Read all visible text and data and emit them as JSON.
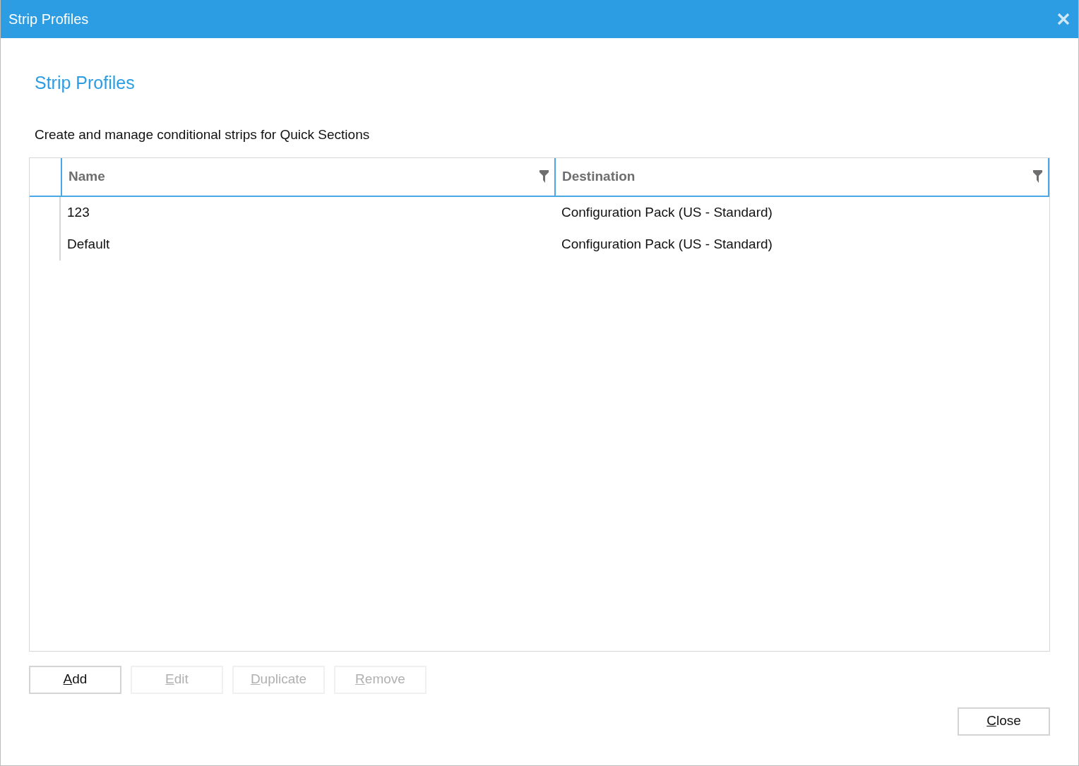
{
  "window": {
    "title": "Strip Profiles"
  },
  "heading": "Strip Profiles",
  "description": "Create and manage conditional strips for Quick Sections",
  "table": {
    "columns": [
      {
        "label": "Name"
      },
      {
        "label": "Destination"
      }
    ],
    "rows": [
      {
        "cells": [
          "123",
          "Configuration Pack (US - Standard)"
        ]
      },
      {
        "cells": [
          "Default",
          "Configuration Pack (US - Standard)"
        ]
      }
    ]
  },
  "actions": [
    {
      "label": "Add",
      "underline_first": true,
      "disabled": false
    },
    {
      "label": "Edit",
      "underline_first": true,
      "disabled": true
    },
    {
      "label": "Duplicate",
      "underline_first": true,
      "disabled": true
    },
    {
      "label": "Remove",
      "underline_first": true,
      "disabled": true
    }
  ],
  "footer_buttons": [
    {
      "label": "Close",
      "underline_first": true,
      "disabled": false
    }
  ]
}
